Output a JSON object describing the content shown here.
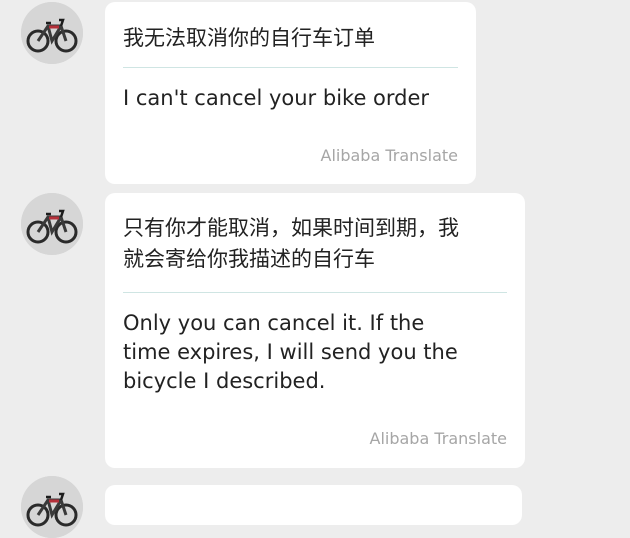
{
  "messages": [
    {
      "original": "我无法取消你的自行车订单",
      "translation": "I can't cancel your bike order",
      "attribution": "Alibaba Translate",
      "avatar_icon": "bicycle-icon"
    },
    {
      "original": "只有你才能取消，如果时间到期，我\n就会寄给你我描述的自行车",
      "translation": "Only you can cancel it. If the\ntime expires, I will send you the\nbicycle I described.",
      "attribution": "Alibaba Translate",
      "avatar_icon": "bicycle-icon"
    },
    {
      "avatar_icon": "bicycle-icon"
    }
  ],
  "colors": {
    "background": "#ededed",
    "bubble": "#ffffff",
    "divider": "#cfe5e3",
    "attribution": "#a6a6a6",
    "text": "#222222"
  }
}
